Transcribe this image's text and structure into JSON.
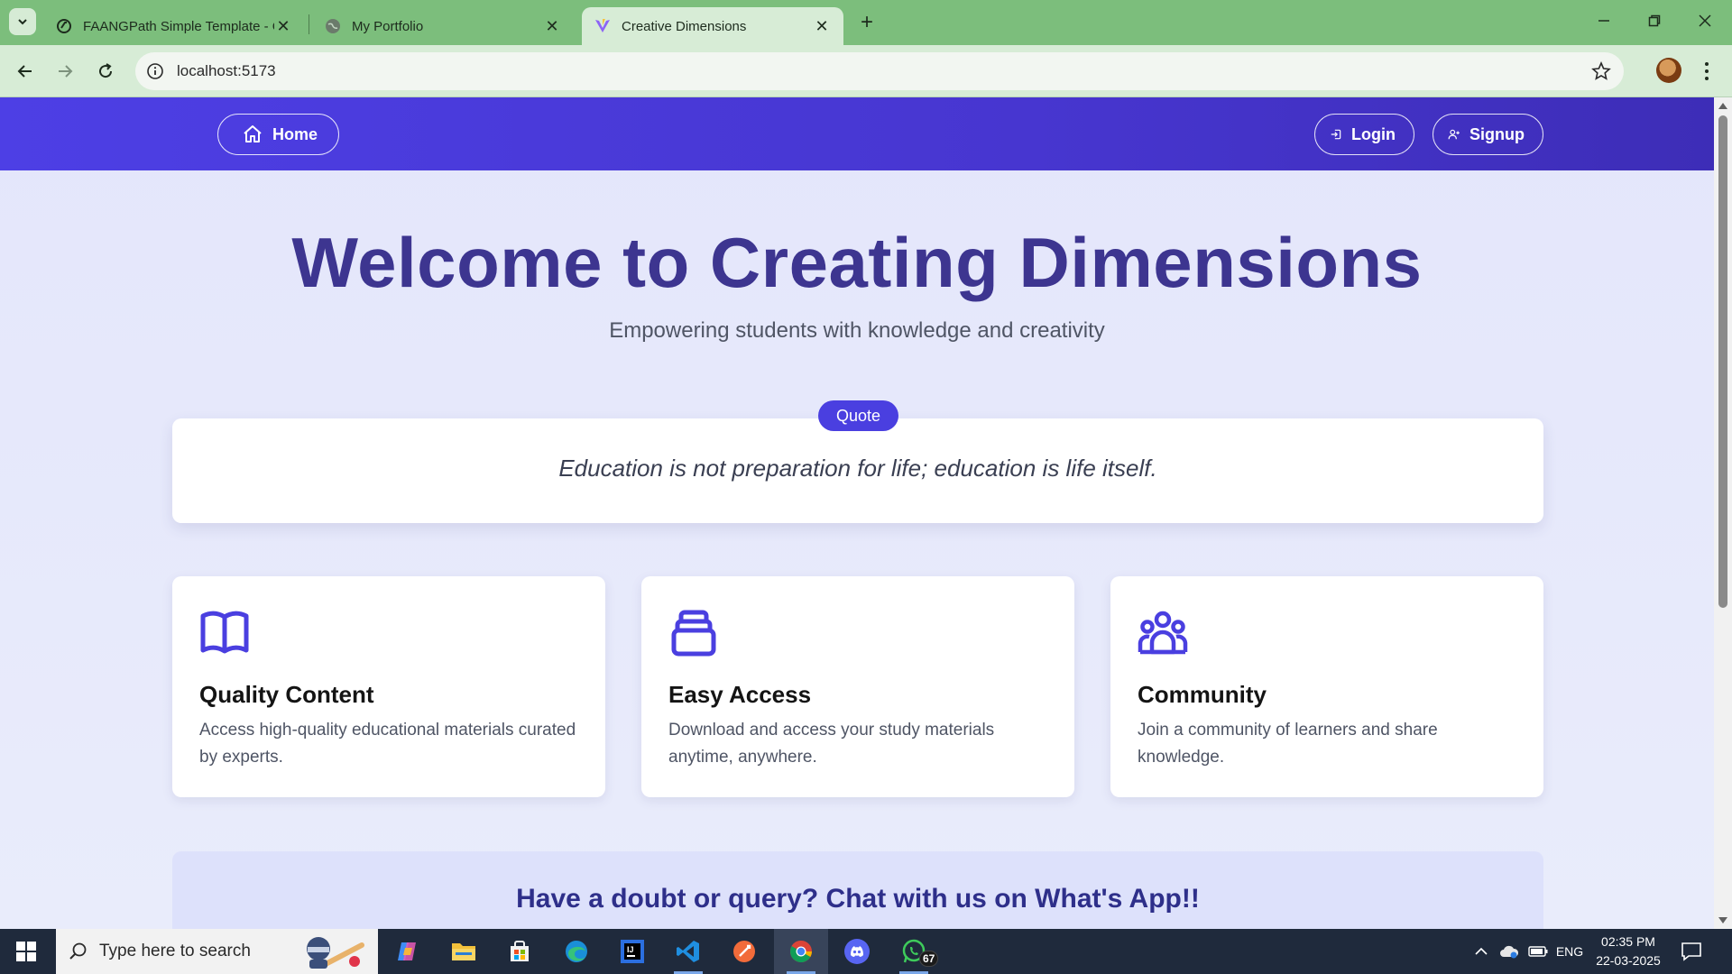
{
  "browser": {
    "tabs": [
      {
        "title": "FAANGPath Simple Template - C",
        "active": false
      },
      {
        "title": "My Portfolio",
        "active": false
      },
      {
        "title": "Creative Dimensions",
        "active": true
      }
    ],
    "url": "localhost:5173"
  },
  "site": {
    "nav": {
      "home_label": "Home",
      "login_label": "Login",
      "signup_label": "Signup",
      "accent_color": "#4a3fe0"
    },
    "hero": {
      "title": "Welcome to Creating Dimensions",
      "subtitle": "Empowering students with knowledge and creativity"
    },
    "quote": {
      "badge": "Quote",
      "text": "Education is not preparation for life; education is life itself."
    },
    "features": [
      {
        "icon": "book-open-icon",
        "title": "Quality Content",
        "description": "Access high-quality educational materials curated by experts."
      },
      {
        "icon": "archive-box-icon",
        "title": "Easy Access",
        "description": "Download and access your study materials anytime, anywhere."
      },
      {
        "icon": "users-group-icon",
        "title": "Community",
        "description": "Join a community of learners and share knowledge."
      }
    ],
    "cta": {
      "title": "Have a doubt or query? Chat with us on What's App!!"
    }
  },
  "taskbar": {
    "search_placeholder": "Type here to search",
    "apps": [
      "copilot-icon",
      "file-explorer-icon",
      "microsoft-store-icon",
      "edge-icon",
      "intellij-icon",
      "vscode-icon",
      "postman-icon",
      "chrome-icon",
      "discord-icon",
      "whatsapp-icon"
    ],
    "whatsapp_badge": "67",
    "language": "ENG",
    "time": "02:35 PM",
    "date": "22-03-2025"
  }
}
